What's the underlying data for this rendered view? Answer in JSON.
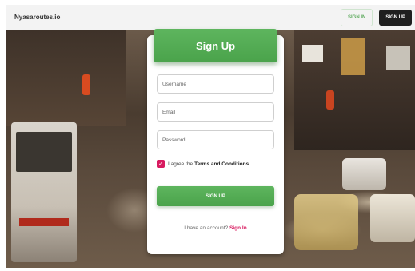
{
  "header": {
    "brand": "Nyasaroutes.io",
    "signin_label": "SIGN IN",
    "signup_label": "SIGN UP"
  },
  "form": {
    "title": "Sign Up",
    "username_placeholder": "Username",
    "email_placeholder": "Email",
    "password_placeholder": "Password",
    "terms_prefix": "I agree the",
    "terms_link": "Terms and Conditions",
    "terms_checked": true,
    "submit_label": "SIGN UP",
    "have_account_text": "I have an account?",
    "signin_link": "Sign In"
  },
  "colors": {
    "accent_green": "#4aa34b",
    "accent_pink": "#d81b60",
    "dark_button": "#1f1f1f"
  },
  "icons": {
    "checkbox": "check-icon"
  }
}
